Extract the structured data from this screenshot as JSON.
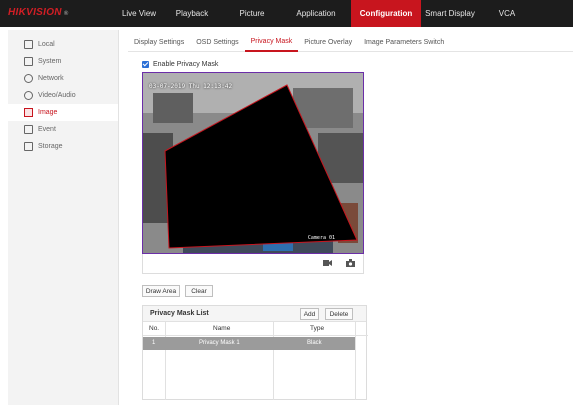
{
  "brand": {
    "logo": "HIKVISION",
    "reg": "®"
  },
  "nav": {
    "items": [
      {
        "label": "Live View",
        "w": 0
      },
      {
        "label": "Playback"
      },
      {
        "label": "Picture"
      },
      {
        "label": "Application"
      },
      {
        "label": "Configuration",
        "active": true
      },
      {
        "label": "Smart Display"
      },
      {
        "label": "VCA"
      }
    ]
  },
  "sidebar": {
    "items": [
      {
        "label": "Local",
        "icon": "monitor-icon"
      },
      {
        "label": "System",
        "icon": "system-icon"
      },
      {
        "label": "Network",
        "icon": "network-icon"
      },
      {
        "label": "Video/Audio",
        "icon": "video-audio-icon"
      },
      {
        "label": "Image",
        "icon": "image-icon",
        "active": true
      },
      {
        "label": "Event",
        "icon": "event-icon"
      },
      {
        "label": "Storage",
        "icon": "storage-icon"
      }
    ]
  },
  "subtabs": [
    {
      "label": "Display Settings"
    },
    {
      "label": "OSD Settings"
    },
    {
      "label": "Privacy Mask",
      "active": true
    },
    {
      "label": "Picture Overlay"
    },
    {
      "label": "Image Parameters Switch"
    }
  ],
  "enable_privacy_mask": {
    "label": "Enable Privacy Mask",
    "checked": true
  },
  "video": {
    "timestamp": "03-07-2019 Thu 12:13:42",
    "camera_label": "Camera 01"
  },
  "buttons": {
    "draw_area": "Draw Area",
    "clear": "Clear"
  },
  "mask_list": {
    "title": "Privacy Mask List",
    "add": "Add",
    "delete": "Delete",
    "columns": {
      "no": "No.",
      "name": "Name",
      "type": "Type"
    },
    "rows": [
      {
        "no": "1",
        "name": "Privacy Mask 1",
        "type": "Black"
      }
    ]
  },
  "colors": {
    "accent": "#c8151e",
    "topbar": "#1c1c1c",
    "selected_row": "#9b9b9b",
    "mask": "#000000",
    "mask_border": "#c8151e"
  }
}
